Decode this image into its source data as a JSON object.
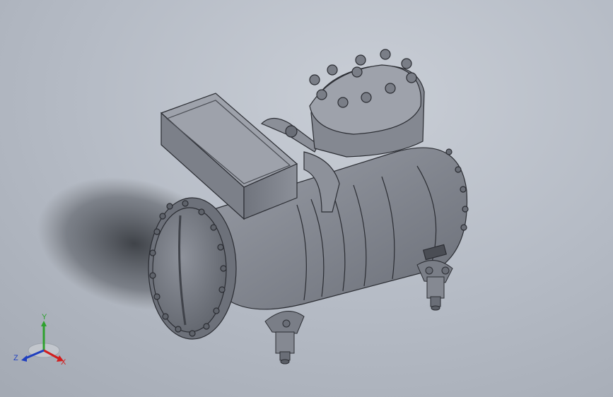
{
  "viewport": {
    "background_top": "#c9ced6",
    "background_bottom": "#9ea4ae"
  },
  "model": {
    "body_color": "#7f838c",
    "edge_color": "#2b2d33"
  },
  "triad": {
    "x_label": "X",
    "y_label": "Y",
    "z_label": "Z",
    "x_color": "#d21d1d",
    "y_color": "#2ea12e",
    "z_color": "#1f3fbf"
  }
}
